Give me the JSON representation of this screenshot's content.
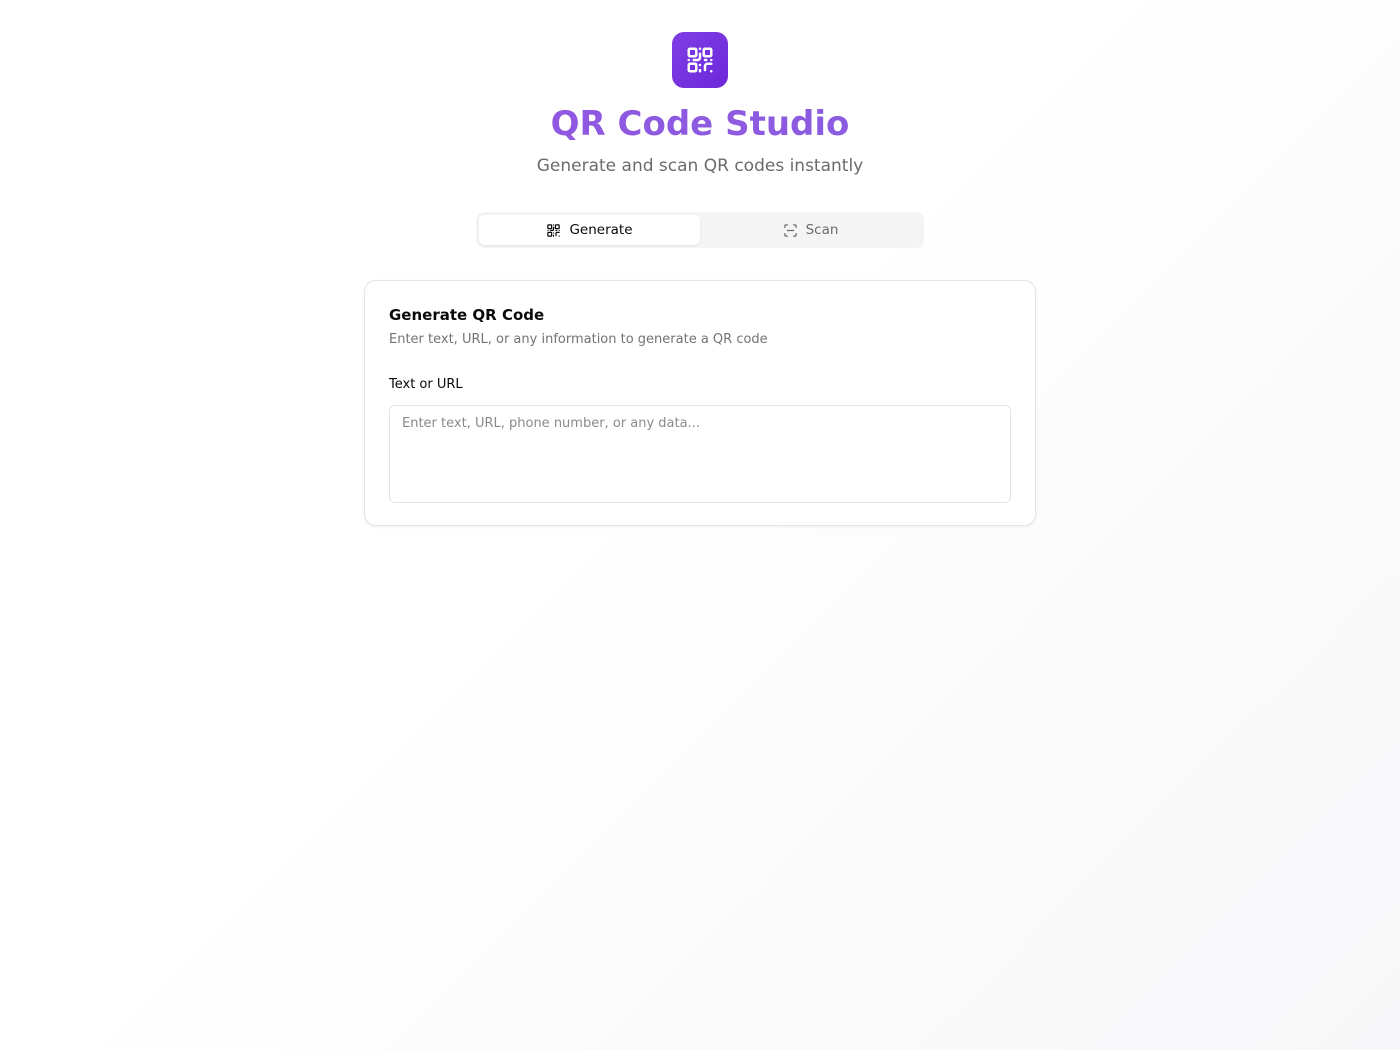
{
  "header": {
    "logo_icon": "qr-code-icon",
    "title": "QR Code Studio",
    "subtitle": "Generate and scan QR codes instantly"
  },
  "tabs": [
    {
      "label": "Generate",
      "icon": "qr-code-icon",
      "active": true
    },
    {
      "label": "Scan",
      "icon": "scan-icon",
      "active": false
    }
  ],
  "card": {
    "title": "Generate QR Code",
    "description": "Enter text, URL, or any information to generate a QR code",
    "field_label": "Text or URL",
    "input_value": "",
    "input_placeholder": "Enter text, URL, phone number, or any data..."
  },
  "colors": {
    "accent": "#7c3aed",
    "title_gradient_start": "#9a4de3",
    "title_gradient_end": "#7c6bdc"
  }
}
